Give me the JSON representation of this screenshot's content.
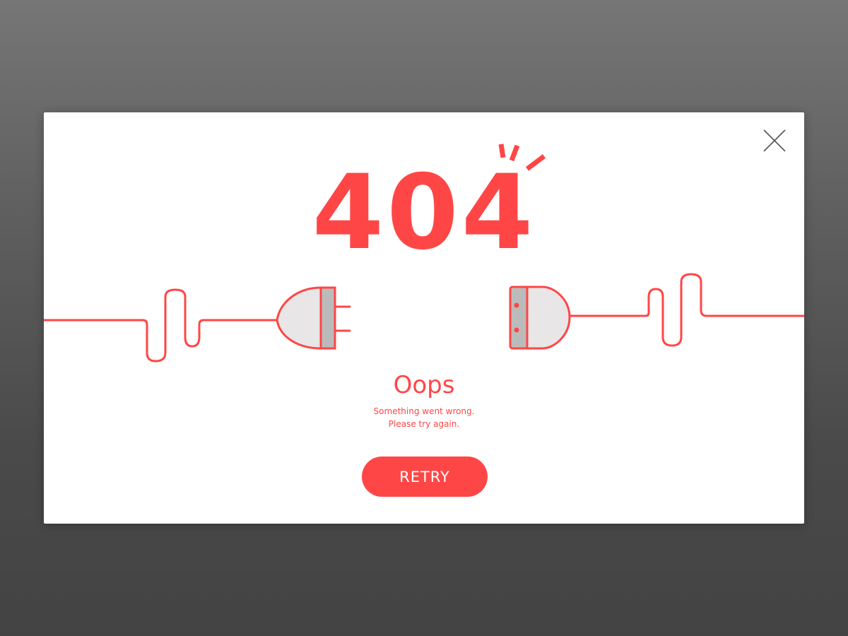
{
  "dialog": {
    "error_code": "404",
    "title": "Oops",
    "message_line_1": "Something went wrong.",
    "message_line_2": "Please try again.",
    "retry_label": "RETRY",
    "close_icon": "close-icon",
    "illustration": "unplugged-cable"
  },
  "colors": {
    "accent": "#ff4646",
    "plug_body": "#e8e6e6",
    "plug_band": "#bbbbbb",
    "backdrop": "#5a5a5a",
    "modal": "#ffffff",
    "close_icon": "#555555"
  }
}
